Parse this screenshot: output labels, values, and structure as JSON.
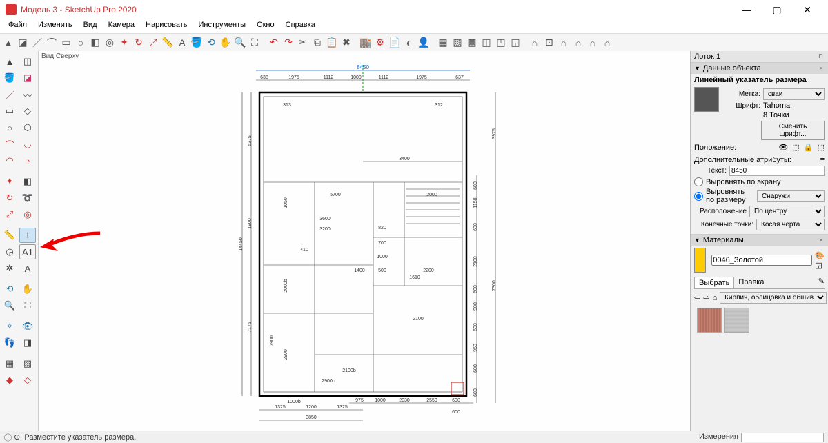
{
  "window": {
    "title": "Модель 3 - SketchUp Pro 2020"
  },
  "menu": [
    "Файл",
    "Изменить",
    "Вид",
    "Камера",
    "Нарисовать",
    "Инструменты",
    "Окно",
    "Справка"
  ],
  "viewport": {
    "title": "Вид Сверху"
  },
  "tray": {
    "title": "Лоток 1",
    "entity": {
      "header": "Данные объекта",
      "subheader": "Линейный указатель размера",
      "label_tag": "Метка:",
      "tag_value": "сваи",
      "label_font": "Шрифт:",
      "font_value": "Tahoma",
      "points": "8 Точки",
      "change_font": "Сменить шрифт...",
      "position": "Положение:",
      "extra_attrs": "Дополнительные атрибуты:",
      "text_label": "Текст:",
      "text_value": "8450",
      "align_screen": "Выровнять по экрану",
      "align_dim": "Выровнять по размеру",
      "outside": "Снаружи",
      "placement": "Расположение",
      "placement_val": "По центру",
      "endpoints": "Конечные точки:",
      "endpoints_val": "Косая черта"
    },
    "materials": {
      "header": "Материалы",
      "name": "0046_Золотой",
      "tab_select": "Выбрать",
      "tab_edit": "Правка",
      "collection": "Кирпич, облицовка и обшив"
    }
  },
  "status": {
    "hint": "Разместите указатель размера.",
    "measure_label": "Измерения"
  },
  "dims": {
    "top_total": "8450",
    "top_seg": [
      "638",
      "1975",
      "1112",
      "1000",
      "1112",
      "1975",
      "637"
    ],
    "left_total": "14450",
    "left_seg": [
      "5375",
      "1900",
      "7175"
    ],
    "right_outer": [
      "3975",
      "7300"
    ],
    "right_inner": [
      "600",
      "1150",
      "600",
      "2100",
      "600",
      "900",
      "600",
      "950",
      "600",
      "600"
    ],
    "bottom_total": "3850",
    "bottom_seg": [
      "1325",
      "1200",
      "1325"
    ],
    "bottom_r": [
      "975",
      "1000",
      "2030",
      "2550",
      "600",
      "600"
    ],
    "inner": {
      "a": "313",
      "b": "312",
      "c": "3400",
      "d": "5700",
      "e": "2000",
      "f": "1050",
      "g": "3600",
      "h": "3200",
      "i": "410",
      "j": "2200",
      "k": "1610",
      "l": "2100",
      "m": "2100b",
      "n": "1400",
      "o": "820",
      "p": "700",
      "q": "1000",
      "r": "500",
      "s": "1000b",
      "t": "2900",
      "u": "7900",
      "v": "2000b",
      "w": "2900b"
    }
  }
}
